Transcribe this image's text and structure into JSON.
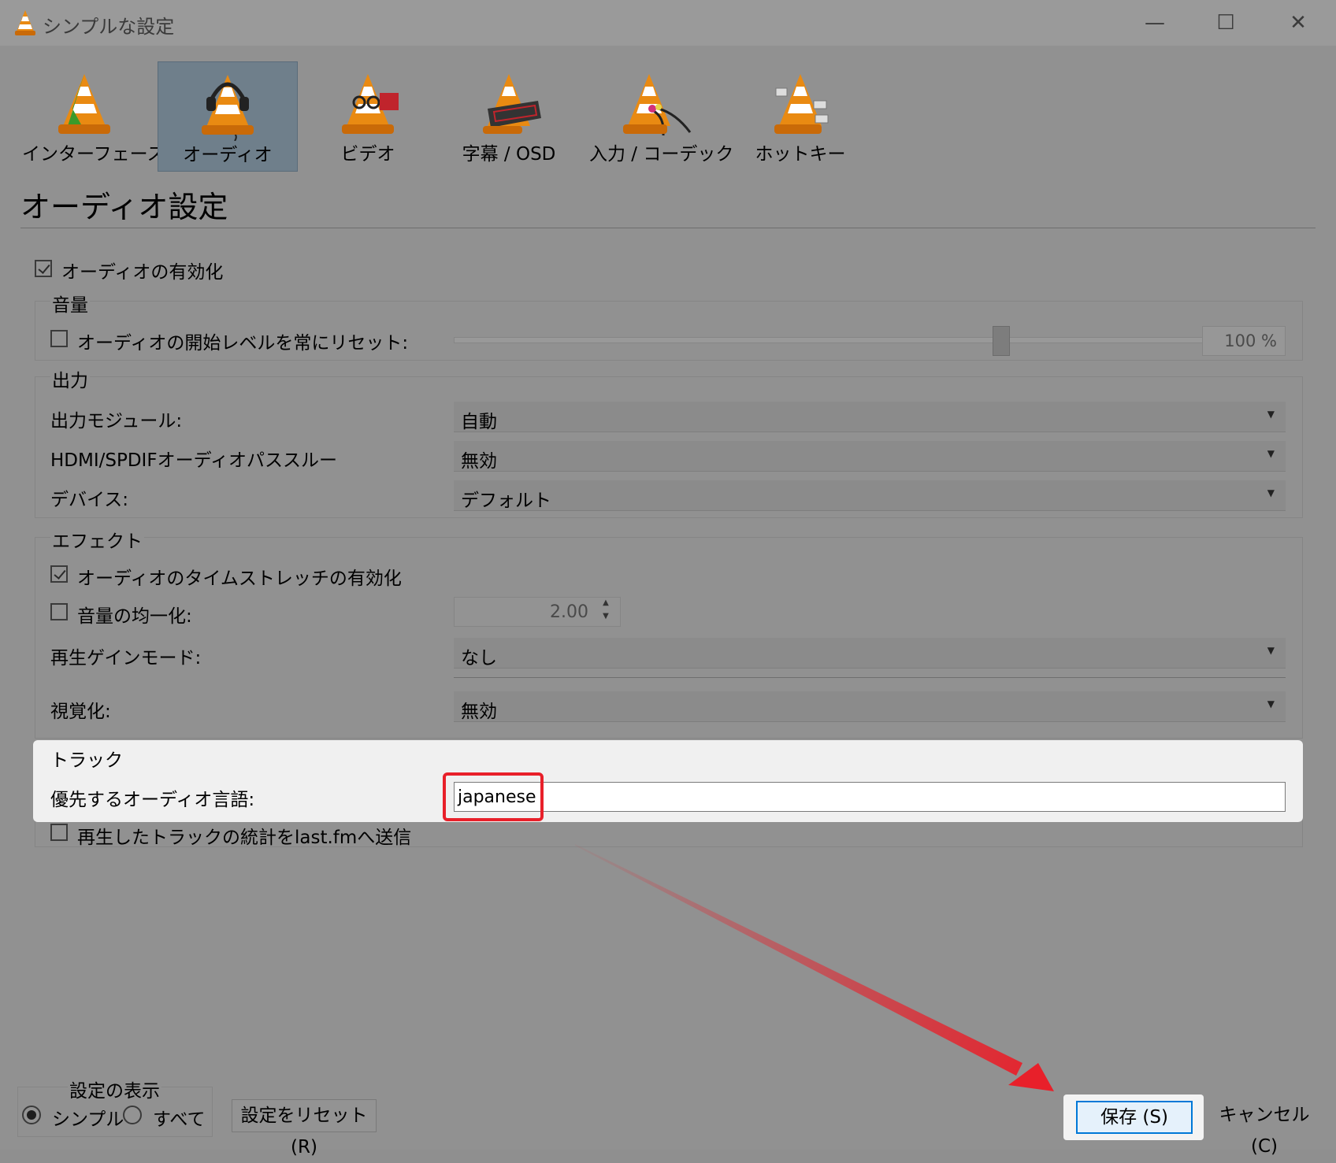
{
  "window": {
    "title": "シンプルな設定",
    "minimize": "—",
    "maximize": "☐",
    "close": "✕"
  },
  "categories": [
    {
      "label": "インターフェース",
      "icon": "interface-cone-icon"
    },
    {
      "label": "オーディオ",
      "icon": "audio-cone-icon"
    },
    {
      "label": "ビデオ",
      "icon": "video-cone-icon"
    },
    {
      "label": "字幕 / OSD",
      "icon": "subtitle-cone-icon"
    },
    {
      "label": "入力 / コーデック",
      "icon": "codec-cone-icon"
    },
    {
      "label": "ホットキー",
      "icon": "hotkey-cone-icon"
    }
  ],
  "selected_category": "オーディオ",
  "heading": "オーディオ設定",
  "enable_audio": {
    "label": "オーディオの有効化",
    "checked": true
  },
  "volume": {
    "group": "音量",
    "reset_label": "オーディオの開始レベルを常にリセット:",
    "reset_checked": false,
    "value": "100 %",
    "level_fraction": 0.73
  },
  "output": {
    "group": "出力",
    "module_label": "出力モジュール:",
    "module_value": "自動",
    "passthrough_label": "HDMI/SPDIFオーディオパススルー",
    "passthrough_value": "無効",
    "device_label": "デバイス:",
    "device_value": "デフォルト"
  },
  "effects": {
    "group": "エフェクト",
    "timestretch_label": "オーディオのタイムストレッチの有効化",
    "timestretch_checked": true,
    "normalize_label": "音量の均一化:",
    "normalize_checked": false,
    "normalize_value": "2.00",
    "replaygain_label": "再生ゲインモード:",
    "replaygain_value": "なし",
    "visual_label": "視覚化:",
    "visual_value": "無効"
  },
  "tracks": {
    "group": "トラック",
    "lang_label": "優先するオーディオ言語:",
    "lang_value": "japanese",
    "lastfm_label": "再生したトラックの統計をlast.fmへ送信",
    "lastfm_checked": false
  },
  "footer": {
    "show_label": "設定の表示",
    "simple_label": "シンプル",
    "all_label": "すべて",
    "mode": "シンプル",
    "reset_label": "設定をリセット (R)",
    "save_label": "保存 (S)",
    "cancel_label": "キャンセル (C)"
  },
  "colors": {
    "highlight": "#e8202a",
    "accent": "#0078d7"
  }
}
